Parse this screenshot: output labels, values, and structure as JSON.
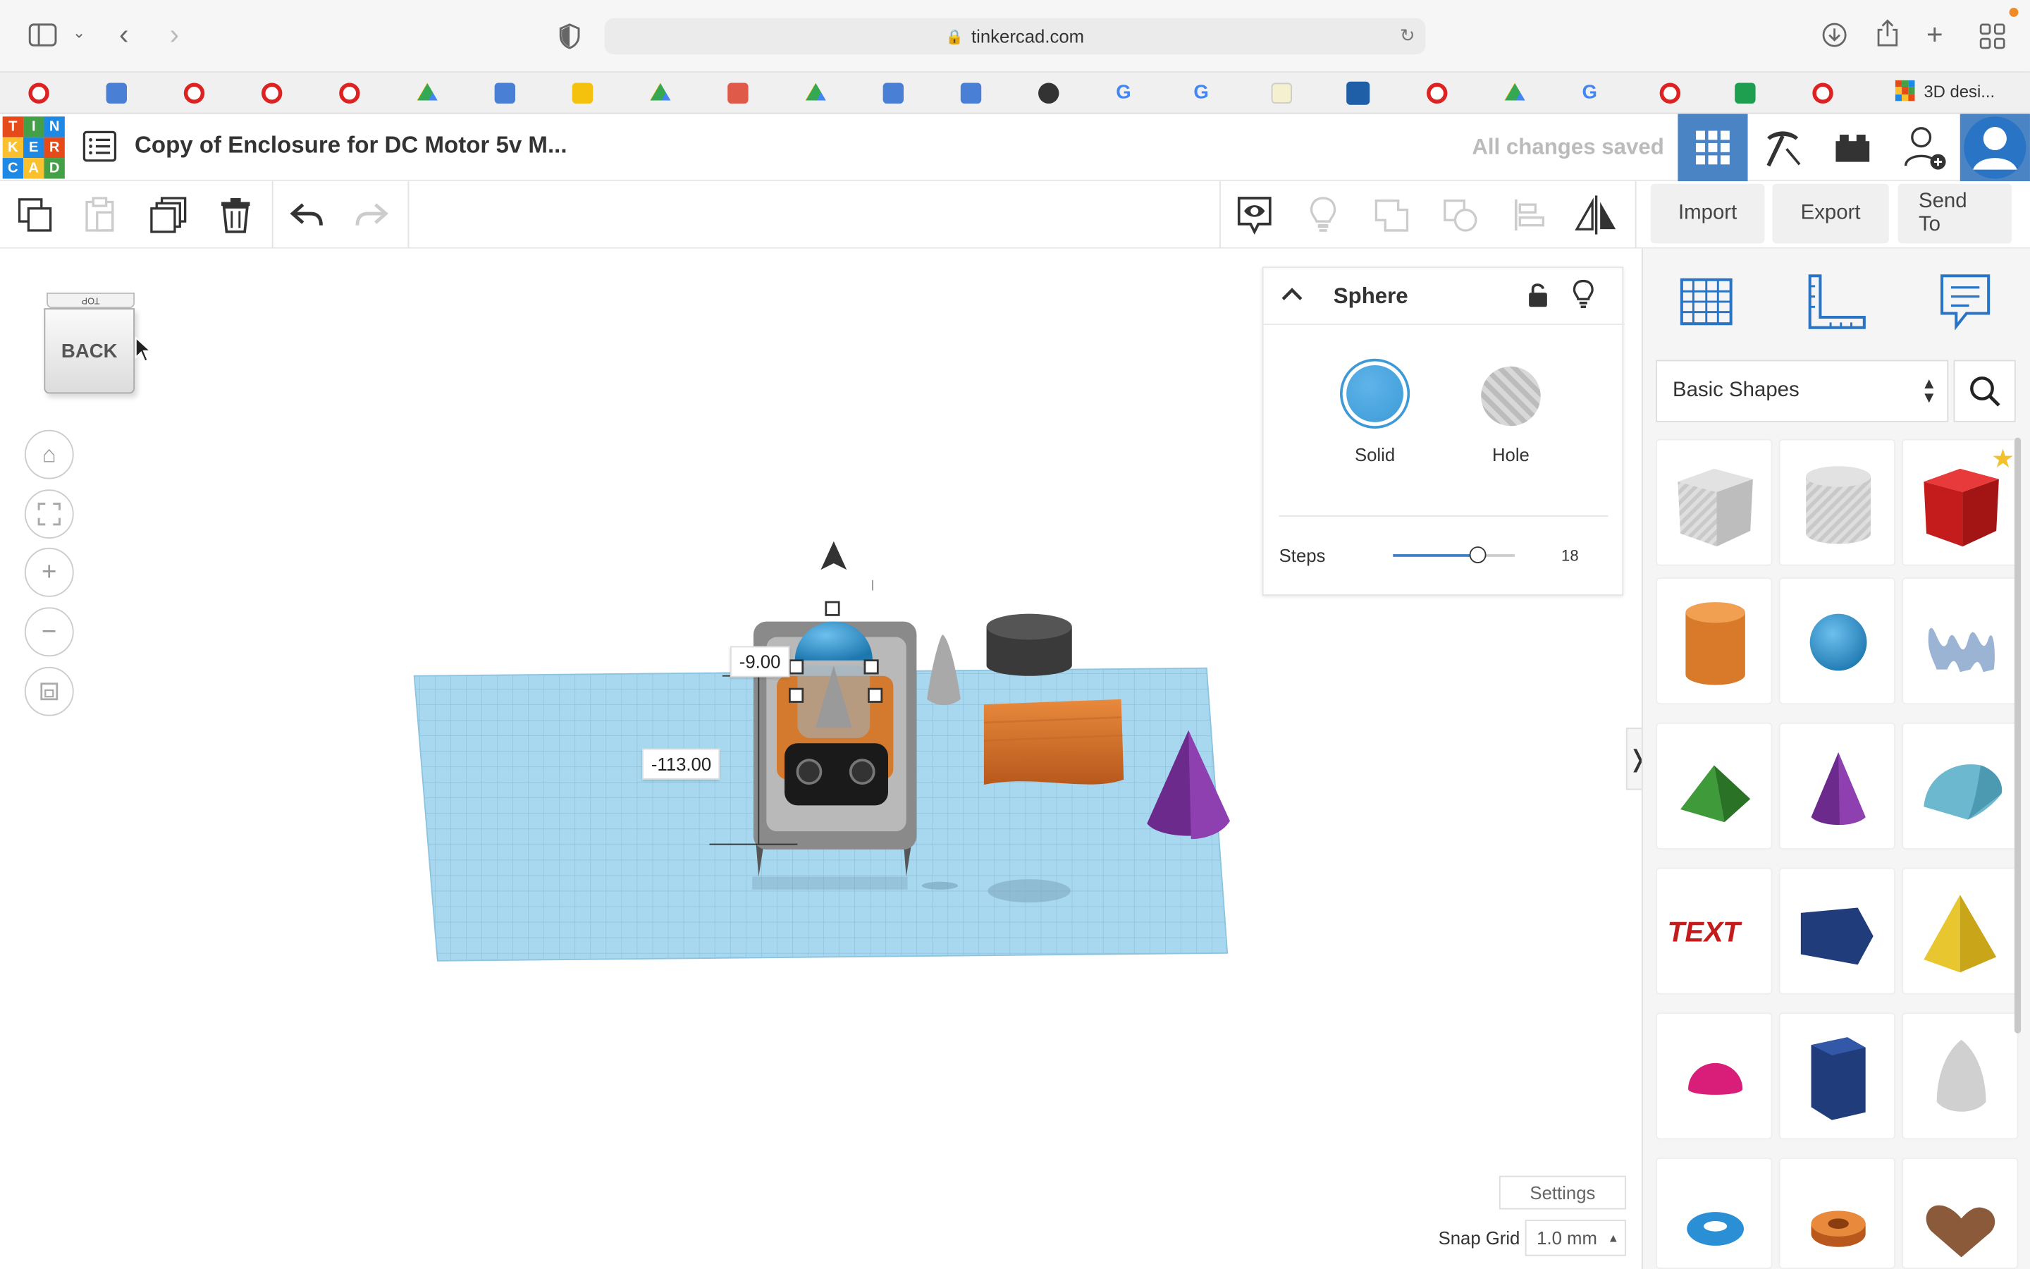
{
  "browser": {
    "url": "tinkercad.com",
    "active_tab_label": "3D desi..."
  },
  "header": {
    "logo_letters": [
      "T",
      "I",
      "N",
      "K",
      "E",
      "R",
      "C",
      "A",
      "D"
    ],
    "design_title": "Copy of Enclosure for DC Motor 5v M...",
    "save_status": "All changes saved"
  },
  "toolbar": {
    "import_label": "Import",
    "export_label": "Export",
    "send_to_label": "Send To"
  },
  "viewcube": {
    "face_label": "BACK",
    "top_label": "TOP"
  },
  "dimensions": {
    "height_value": "-9.00",
    "offset_value": "-113.00"
  },
  "inspector": {
    "shape_name": "Sphere",
    "solid_label": "Solid",
    "hole_label": "Hole",
    "steps_label": "Steps",
    "steps_value": "18",
    "steps_fraction": 0.69,
    "solid_color": "#3d9ad6"
  },
  "library": {
    "category": "Basic Shapes"
  },
  "footer": {
    "settings_label": "Settings",
    "snap_grid_label": "Snap Grid",
    "snap_grid_value": "1.0 mm"
  },
  "colors": {
    "accent": "#4b84c4",
    "workplane": "#a8d8ef"
  }
}
